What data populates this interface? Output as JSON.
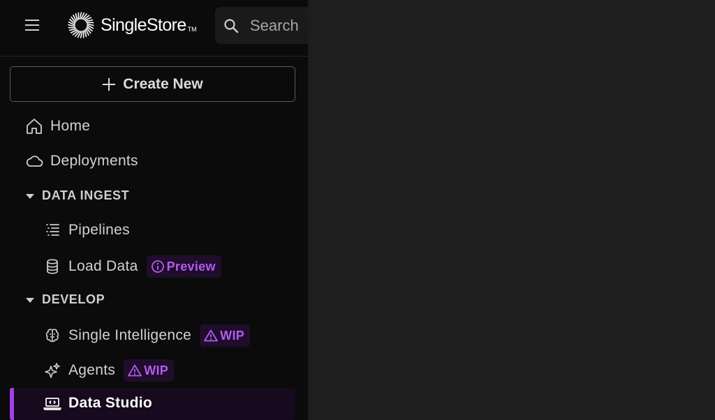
{
  "header": {
    "brand_name": "SingleStore",
    "brand_tm": "TM",
    "search_placeholder": "Search"
  },
  "create_button": {
    "label": "Create New"
  },
  "nav": {
    "home": "Home",
    "deployments": "Deployments"
  },
  "sections": [
    {
      "title": "DATA INGEST",
      "items": [
        {
          "label": "Pipelines",
          "icon": "pipelines-icon"
        },
        {
          "label": "Load Data",
          "icon": "database-icon",
          "badge": "Preview",
          "badge_icon": "info-icon"
        }
      ]
    },
    {
      "title": "DEVELOP",
      "items": [
        {
          "label": "Single Intelligence",
          "icon": "brain-icon",
          "badge": "WIP",
          "badge_icon": "warning-icon"
        },
        {
          "label": "Agents",
          "icon": "sparkle-icon",
          "badge": "WIP",
          "badge_icon": "warning-icon"
        },
        {
          "label": "Data Studio",
          "icon": "laptop-code-icon",
          "active": true
        }
      ]
    }
  ],
  "colors": {
    "accent": "#a440e8",
    "badge_text": "#b25bef",
    "badge_bg": "#1f0d2b",
    "sidebar_bg": "#0b0b0b",
    "main_bg": "#1e1e1e"
  }
}
